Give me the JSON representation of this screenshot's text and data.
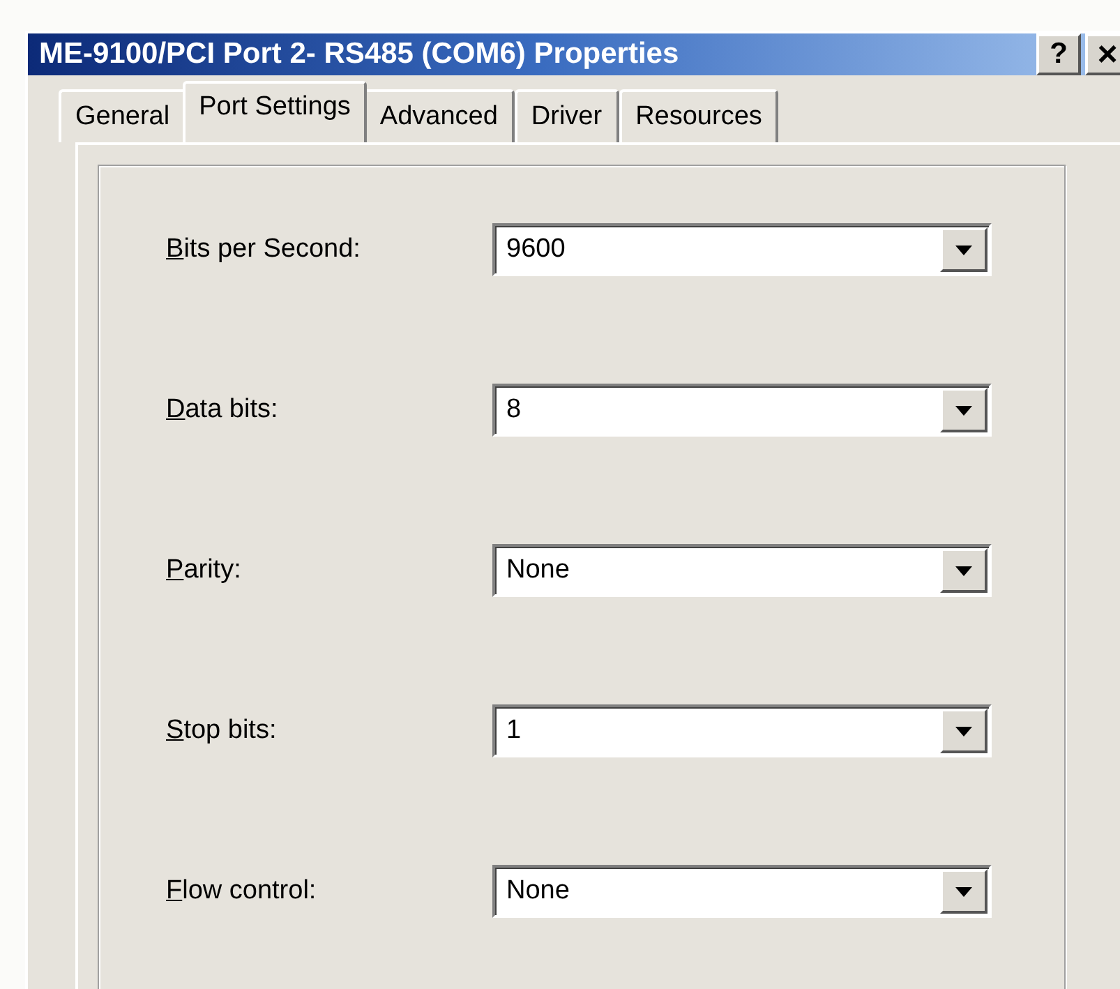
{
  "window": {
    "title": "ME-9100/PCI Port 2- RS485 (COM6) Properties",
    "buttons": [
      {
        "kind": "help",
        "label": "?"
      },
      {
        "kind": "close",
        "label": "×"
      }
    ]
  },
  "tabs": [
    {
      "label": "General",
      "selected": false
    },
    {
      "label": "Port Settings",
      "selected": true
    },
    {
      "label": "Advanced",
      "selected": false
    },
    {
      "label": "Driver",
      "selected": false
    },
    {
      "label": "Resources",
      "selected": false
    }
  ],
  "settings": [
    {
      "label": "Bits per Second:",
      "value": "9600"
    },
    {
      "label": "Data bits:",
      "value": "8"
    },
    {
      "label": "Parity:",
      "value": "None"
    },
    {
      "label": "Stop bits:",
      "value": "1"
    },
    {
      "label": "Flow control:",
      "value": "None"
    }
  ]
}
